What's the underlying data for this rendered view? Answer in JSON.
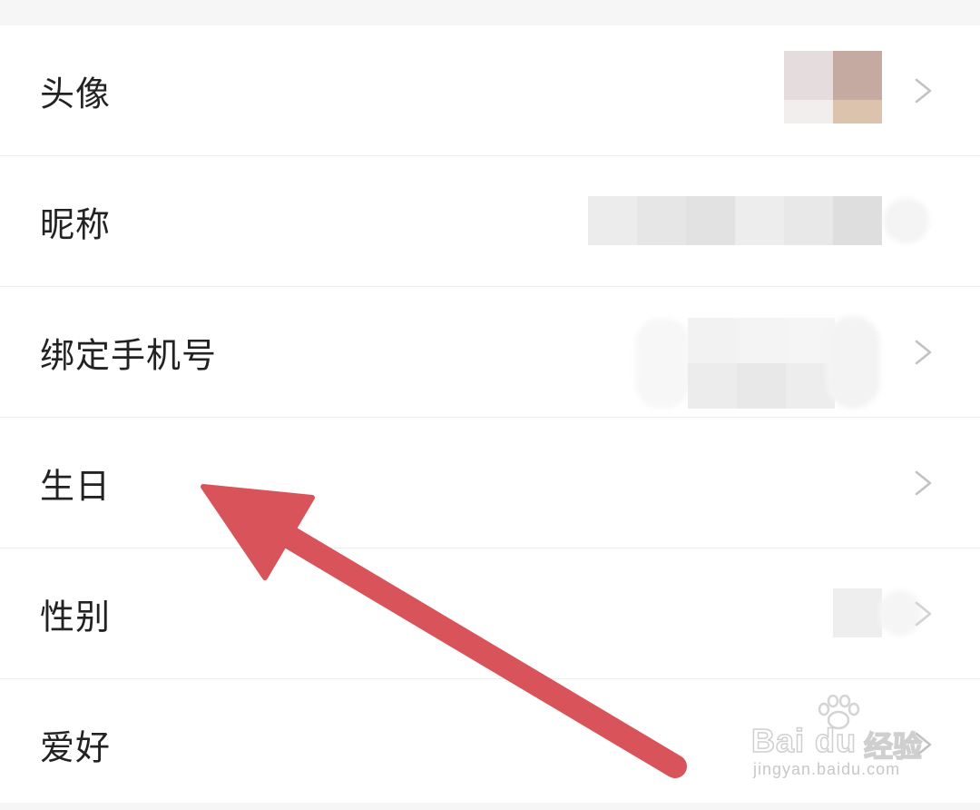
{
  "rows": [
    {
      "label": "头像",
      "chevron": true
    },
    {
      "label": "昵称",
      "chevron": false
    },
    {
      "label": "绑定手机号",
      "chevron": true
    },
    {
      "label": "生日",
      "chevron": true
    },
    {
      "label": "性别",
      "chevron": true
    },
    {
      "label": "爱好",
      "chevron": true
    }
  ],
  "annotation_color": "#d9535a",
  "watermark": {
    "brand": "Bai du",
    "brand_cn": "经验",
    "url": "jingyan.baidu.com"
  },
  "icons": [
    "chevron-right-icon",
    "paw-icon"
  ]
}
